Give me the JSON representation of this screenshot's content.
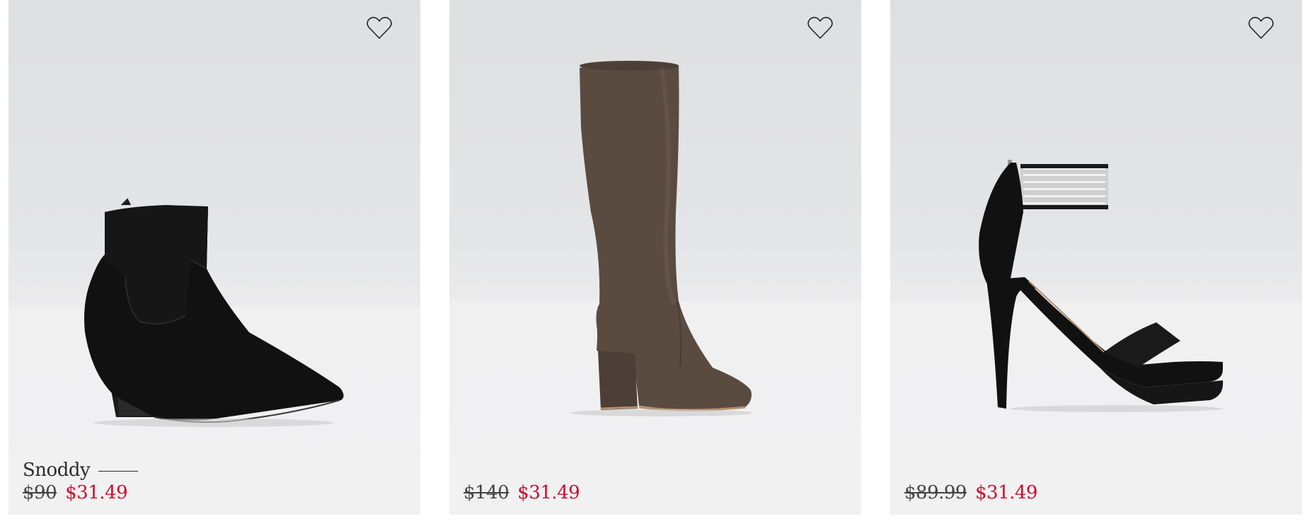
{
  "products": [
    {
      "name": "Snoddy",
      "original_price": "$90",
      "sale_price": "$31.49",
      "image": "black-suede-ankle-bootie",
      "wishlist_icon": "heart-outline-icon"
    },
    {
      "name": "",
      "original_price": "$140",
      "sale_price": "$31.49",
      "image": "taupe-knee-high-block-heel-boot",
      "wishlist_icon": "heart-outline-icon"
    },
    {
      "name": "",
      "original_price": "$89.99",
      "sale_price": "$31.49",
      "image": "black-ankle-strap-platform-sandal",
      "wishlist_icon": "heart-outline-icon"
    }
  ],
  "colors": {
    "sale_price": "#c8102e",
    "text": "#2b2b2b",
    "card_background": "#e4e5e7"
  }
}
